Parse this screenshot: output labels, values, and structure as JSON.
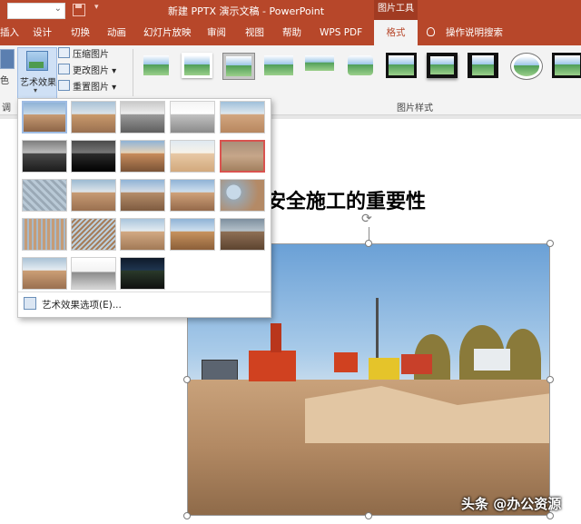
{
  "title_bar": {
    "document_title": "新建 PPTX 演示文稿 - PowerPoint",
    "context_tool": "图片工具",
    "quick_access_more": "▾"
  },
  "tabs": [
    {
      "label": "插入"
    },
    {
      "label": "设计"
    },
    {
      "label": "切换"
    },
    {
      "label": "动画"
    },
    {
      "label": "幻灯片放映"
    },
    {
      "label": "审阅"
    },
    {
      "label": "视图"
    },
    {
      "label": "帮助"
    },
    {
      "label": "WPS PDF"
    },
    {
      "label": "格式"
    },
    {
      "label": "操作说明搜索"
    }
  ],
  "ribbon": {
    "color_label": "色",
    "adjust_group_partial": "调",
    "artistic_effects": "艺术效果",
    "compress": "压缩图片",
    "change": "更改图片",
    "reset": "重置图片",
    "styles_group_label": "图片样式"
  },
  "slide": {
    "heading": "安全施工的重要性"
  },
  "gallery": {
    "thumbnails": [
      "plastic-wrap",
      "paint-brush",
      "pencil-grayscale",
      "pencil-sketch",
      "line-drawing",
      "chalk-sketch",
      "paint-strokes",
      "marker",
      "glow-diffused",
      "blur",
      "cement",
      "watercolor-sponge",
      "film-grain",
      "glass",
      "mosaic-bubbles",
      "texturizer",
      "crisscross-etching",
      "pastels-smooth",
      "cutout",
      "photocopy",
      "light-screen",
      "glow-edges",
      "criss-cross"
    ],
    "options_label": "艺术效果选项(E)..."
  },
  "watermark": "头条 @办公资源"
}
